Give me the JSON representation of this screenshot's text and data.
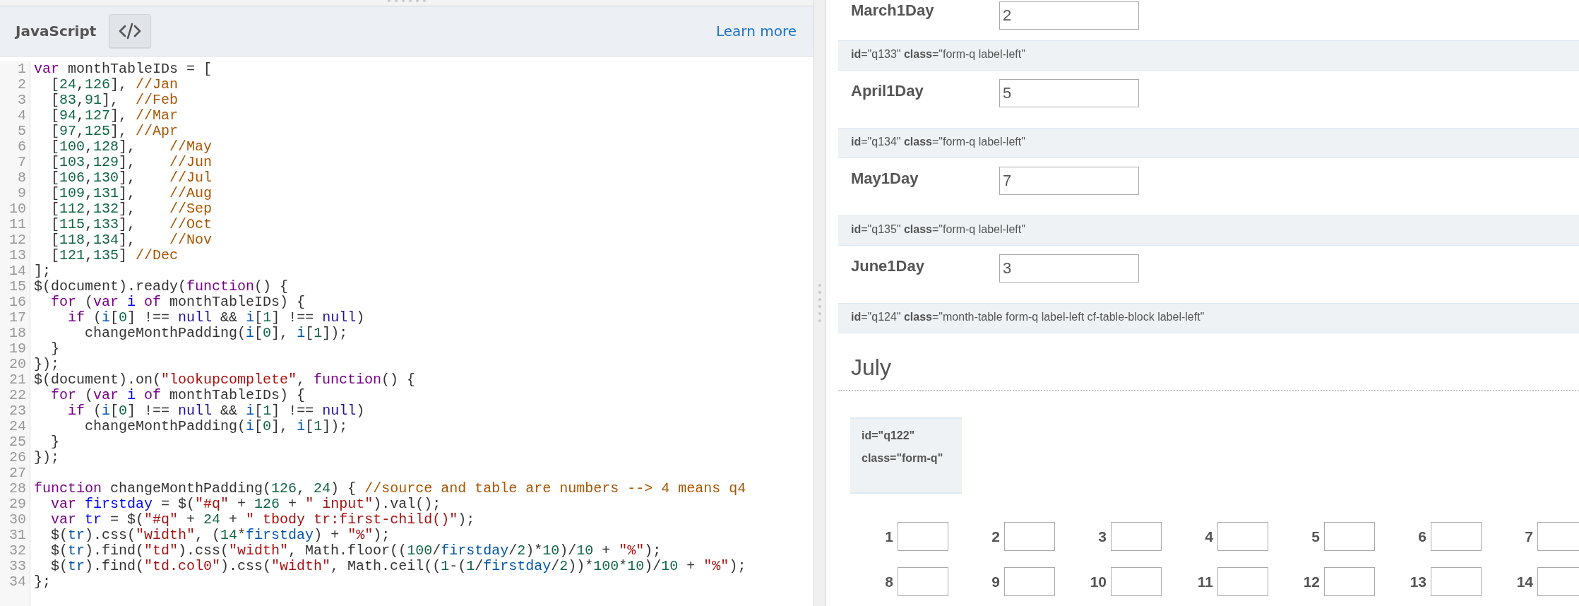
{
  "editor": {
    "language": "JavaScript",
    "link": "Learn more",
    "lines": [
      {
        "number": "1",
        "tokens": [
          {
            "kind": "keyword",
            "text": "var"
          },
          {
            "kind": "plain",
            "text": " monthTableIDs = ["
          }
        ]
      },
      {
        "number": "2",
        "tokens": [
          {
            "kind": "plain",
            "text": "  ["
          },
          {
            "kind": "number",
            "text": "24"
          },
          {
            "kind": "plain",
            "text": ","
          },
          {
            "kind": "number",
            "text": "126"
          },
          {
            "kind": "plain",
            "text": "], "
          },
          {
            "kind": "comment",
            "text": "//Jan"
          }
        ]
      },
      {
        "number": "3",
        "tokens": [
          {
            "kind": "plain",
            "text": "  ["
          },
          {
            "kind": "number",
            "text": "83"
          },
          {
            "kind": "plain",
            "text": ","
          },
          {
            "kind": "number",
            "text": "91"
          },
          {
            "kind": "plain",
            "text": "],  "
          },
          {
            "kind": "comment",
            "text": "//Feb"
          }
        ]
      },
      {
        "number": "4",
        "tokens": [
          {
            "kind": "plain",
            "text": "  ["
          },
          {
            "kind": "number",
            "text": "94"
          },
          {
            "kind": "plain",
            "text": ","
          },
          {
            "kind": "number",
            "text": "127"
          },
          {
            "kind": "plain",
            "text": "], "
          },
          {
            "kind": "comment",
            "text": "//Mar"
          }
        ]
      },
      {
        "number": "5",
        "tokens": [
          {
            "kind": "plain",
            "text": "  ["
          },
          {
            "kind": "number",
            "text": "97"
          },
          {
            "kind": "plain",
            "text": ","
          },
          {
            "kind": "number",
            "text": "125"
          },
          {
            "kind": "plain",
            "text": "], "
          },
          {
            "kind": "comment",
            "text": "//Apr"
          }
        ]
      },
      {
        "number": "6",
        "tokens": [
          {
            "kind": "plain",
            "text": "  ["
          },
          {
            "kind": "number",
            "text": "100"
          },
          {
            "kind": "plain",
            "text": ","
          },
          {
            "kind": "number",
            "text": "128"
          },
          {
            "kind": "plain",
            "text": "],    "
          },
          {
            "kind": "comment",
            "text": "//May"
          }
        ]
      },
      {
        "number": "7",
        "tokens": [
          {
            "kind": "plain",
            "text": "  ["
          },
          {
            "kind": "number",
            "text": "103"
          },
          {
            "kind": "plain",
            "text": ","
          },
          {
            "kind": "number",
            "text": "129"
          },
          {
            "kind": "plain",
            "text": "],    "
          },
          {
            "kind": "comment",
            "text": "//Jun"
          }
        ]
      },
      {
        "number": "8",
        "tokens": [
          {
            "kind": "plain",
            "text": "  ["
          },
          {
            "kind": "number",
            "text": "106"
          },
          {
            "kind": "plain",
            "text": ","
          },
          {
            "kind": "number",
            "text": "130"
          },
          {
            "kind": "plain",
            "text": "],    "
          },
          {
            "kind": "comment",
            "text": "//Jul"
          }
        ]
      },
      {
        "number": "9",
        "tokens": [
          {
            "kind": "plain",
            "text": "  ["
          },
          {
            "kind": "number",
            "text": "109"
          },
          {
            "kind": "plain",
            "text": ","
          },
          {
            "kind": "number",
            "text": "131"
          },
          {
            "kind": "plain",
            "text": "],    "
          },
          {
            "kind": "comment",
            "text": "//Aug"
          }
        ]
      },
      {
        "number": "10",
        "tokens": [
          {
            "kind": "plain",
            "text": "  ["
          },
          {
            "kind": "number",
            "text": "112"
          },
          {
            "kind": "plain",
            "text": ","
          },
          {
            "kind": "number",
            "text": "132"
          },
          {
            "kind": "plain",
            "text": "],    "
          },
          {
            "kind": "comment",
            "text": "//Sep"
          }
        ]
      },
      {
        "number": "11",
        "tokens": [
          {
            "kind": "plain",
            "text": "  ["
          },
          {
            "kind": "number",
            "text": "115"
          },
          {
            "kind": "plain",
            "text": ","
          },
          {
            "kind": "number",
            "text": "133"
          },
          {
            "kind": "plain",
            "text": "],    "
          },
          {
            "kind": "comment",
            "text": "//Oct"
          }
        ]
      },
      {
        "number": "12",
        "tokens": [
          {
            "kind": "plain",
            "text": "  ["
          },
          {
            "kind": "number",
            "text": "118"
          },
          {
            "kind": "plain",
            "text": ","
          },
          {
            "kind": "number",
            "text": "134"
          },
          {
            "kind": "plain",
            "text": "],    "
          },
          {
            "kind": "comment",
            "text": "//Nov"
          }
        ]
      },
      {
        "number": "13",
        "tokens": [
          {
            "kind": "plain",
            "text": "  ["
          },
          {
            "kind": "number",
            "text": "121"
          },
          {
            "kind": "plain",
            "text": ","
          },
          {
            "kind": "number",
            "text": "135"
          },
          {
            "kind": "plain",
            "text": "] "
          },
          {
            "kind": "comment",
            "text": "//Dec"
          }
        ]
      },
      {
        "number": "14",
        "tokens": [
          {
            "kind": "plain",
            "text": "];"
          }
        ]
      },
      {
        "number": "15",
        "tokens": [
          {
            "kind": "plain",
            "text": "$(document).ready("
          },
          {
            "kind": "keyword",
            "text": "function"
          },
          {
            "kind": "plain",
            "text": "() {"
          }
        ]
      },
      {
        "number": "16",
        "tokens": [
          {
            "kind": "keyword",
            "text": "  for"
          },
          {
            "kind": "plain",
            "text": " ("
          },
          {
            "kind": "keyword",
            "text": "var"
          },
          {
            "kind": "def",
            "text": " i"
          },
          {
            "kind": "keyword",
            "text": " of"
          },
          {
            "kind": "plain",
            "text": " monthTableIDs) {"
          }
        ]
      },
      {
        "number": "17",
        "tokens": [
          {
            "kind": "keyword",
            "text": "    if"
          },
          {
            "kind": "plain",
            "text": " ("
          },
          {
            "kind": "variable",
            "text": "i"
          },
          {
            "kind": "plain",
            "text": "["
          },
          {
            "kind": "number",
            "text": "0"
          },
          {
            "kind": "plain",
            "text": "] !== "
          },
          {
            "kind": "atom",
            "text": "null"
          },
          {
            "kind": "plain",
            "text": " && "
          },
          {
            "kind": "variable",
            "text": "i"
          },
          {
            "kind": "plain",
            "text": "["
          },
          {
            "kind": "number",
            "text": "1"
          },
          {
            "kind": "plain",
            "text": "] !== "
          },
          {
            "kind": "atom",
            "text": "null"
          },
          {
            "kind": "plain",
            "text": ")"
          }
        ]
      },
      {
        "number": "18",
        "tokens": [
          {
            "kind": "plain",
            "text": "      changeMonthPadding("
          },
          {
            "kind": "variable",
            "text": "i"
          },
          {
            "kind": "plain",
            "text": "["
          },
          {
            "kind": "number",
            "text": "0"
          },
          {
            "kind": "plain",
            "text": "], "
          },
          {
            "kind": "variable",
            "text": "i"
          },
          {
            "kind": "plain",
            "text": "["
          },
          {
            "kind": "number",
            "text": "1"
          },
          {
            "kind": "plain",
            "text": "]);"
          }
        ]
      },
      {
        "number": "19",
        "tokens": [
          {
            "kind": "plain",
            "text": "  }"
          }
        ]
      },
      {
        "number": "20",
        "tokens": [
          {
            "kind": "plain",
            "text": "});"
          }
        ]
      },
      {
        "number": "21",
        "tokens": [
          {
            "kind": "plain",
            "text": "$(document).on("
          },
          {
            "kind": "string",
            "text": "\"lookupcomplete\""
          },
          {
            "kind": "plain",
            "text": ", "
          },
          {
            "kind": "keyword",
            "text": "function"
          },
          {
            "kind": "plain",
            "text": "() {"
          }
        ]
      },
      {
        "number": "22",
        "tokens": [
          {
            "kind": "keyword",
            "text": "  for"
          },
          {
            "kind": "plain",
            "text": " ("
          },
          {
            "kind": "keyword",
            "text": "var"
          },
          {
            "kind": "def",
            "text": " i"
          },
          {
            "kind": "keyword",
            "text": " of"
          },
          {
            "kind": "plain",
            "text": " monthTableIDs) {"
          }
        ]
      },
      {
        "number": "23",
        "tokens": [
          {
            "kind": "keyword",
            "text": "    if"
          },
          {
            "kind": "plain",
            "text": " ("
          },
          {
            "kind": "variable",
            "text": "i"
          },
          {
            "kind": "plain",
            "text": "["
          },
          {
            "kind": "number",
            "text": "0"
          },
          {
            "kind": "plain",
            "text": "] !== "
          },
          {
            "kind": "atom",
            "text": "null"
          },
          {
            "kind": "plain",
            "text": " && "
          },
          {
            "kind": "variable",
            "text": "i"
          },
          {
            "kind": "plain",
            "text": "["
          },
          {
            "kind": "number",
            "text": "1"
          },
          {
            "kind": "plain",
            "text": "] !== "
          },
          {
            "kind": "atom",
            "text": "null"
          },
          {
            "kind": "plain",
            "text": ")"
          }
        ]
      },
      {
        "number": "24",
        "tokens": [
          {
            "kind": "plain",
            "text": "      changeMonthPadding("
          },
          {
            "kind": "variable",
            "text": "i"
          },
          {
            "kind": "plain",
            "text": "["
          },
          {
            "kind": "number",
            "text": "0"
          },
          {
            "kind": "plain",
            "text": "], "
          },
          {
            "kind": "variable",
            "text": "i"
          },
          {
            "kind": "plain",
            "text": "["
          },
          {
            "kind": "number",
            "text": "1"
          },
          {
            "kind": "plain",
            "text": "]);"
          }
        ]
      },
      {
        "number": "25",
        "tokens": [
          {
            "kind": "plain",
            "text": "  }"
          }
        ]
      },
      {
        "number": "26",
        "tokens": [
          {
            "kind": "plain",
            "text": "});"
          }
        ]
      },
      {
        "number": "27"
      },
      {
        "number": "28",
        "tokens": [
          {
            "kind": "keyword",
            "text": "function"
          },
          {
            "kind": "plain",
            "text": " changeMonthPadding("
          },
          {
            "kind": "number",
            "text": "126"
          },
          {
            "kind": "plain",
            "text": ", "
          },
          {
            "kind": "number",
            "text": "24"
          },
          {
            "kind": "plain",
            "text": ") { "
          },
          {
            "kind": "comment",
            "text": "//source and table are numbers --> 4 means q4"
          }
        ]
      },
      {
        "number": "29",
        "tokens": [
          {
            "kind": "keyword",
            "text": "  var"
          },
          {
            "kind": "def",
            "text": " firstday"
          },
          {
            "kind": "plain",
            "text": " = $("
          },
          {
            "kind": "string",
            "text": "\"#q\""
          },
          {
            "kind": "plain",
            "text": " + "
          },
          {
            "kind": "number",
            "text": "126"
          },
          {
            "kind": "plain",
            "text": " + "
          },
          {
            "kind": "string",
            "text": "\" input\""
          },
          {
            "kind": "plain",
            "text": ").val();"
          }
        ]
      },
      {
        "number": "30",
        "tokens": [
          {
            "kind": "keyword",
            "text": "  var"
          },
          {
            "kind": "def",
            "text": " tr"
          },
          {
            "kind": "plain",
            "text": " = $("
          },
          {
            "kind": "string",
            "text": "\"#q\""
          },
          {
            "kind": "plain",
            "text": " + "
          },
          {
            "kind": "number",
            "text": "24"
          },
          {
            "kind": "plain",
            "text": " + "
          },
          {
            "kind": "string",
            "text": "\" tbody tr:first-child()\""
          },
          {
            "kind": "plain",
            "text": ");"
          }
        ]
      },
      {
        "number": "31",
        "tokens": [
          {
            "kind": "plain",
            "text": "  $("
          },
          {
            "kind": "variable",
            "text": "tr"
          },
          {
            "kind": "plain",
            "text": ").css("
          },
          {
            "kind": "string",
            "text": "\"width\""
          },
          {
            "kind": "plain",
            "text": ", ("
          },
          {
            "kind": "number",
            "text": "14"
          },
          {
            "kind": "plain",
            "text": "*"
          },
          {
            "kind": "variable",
            "text": "firstday"
          },
          {
            "kind": "plain",
            "text": ") + "
          },
          {
            "kind": "string",
            "text": "\"%\""
          },
          {
            "kind": "plain",
            "text": ");"
          }
        ]
      },
      {
        "number": "32",
        "tokens": [
          {
            "kind": "plain",
            "text": "  $("
          },
          {
            "kind": "variable",
            "text": "tr"
          },
          {
            "kind": "plain",
            "text": ").find("
          },
          {
            "kind": "string",
            "text": "\"td\""
          },
          {
            "kind": "plain",
            "text": ").css("
          },
          {
            "kind": "string",
            "text": "\"width\""
          },
          {
            "kind": "plain",
            "text": ", Math.floor(("
          },
          {
            "kind": "number",
            "text": "100"
          },
          {
            "kind": "plain",
            "text": "/"
          },
          {
            "kind": "variable",
            "text": "firstday"
          },
          {
            "kind": "plain",
            "text": "/"
          },
          {
            "kind": "number",
            "text": "2"
          },
          {
            "kind": "plain",
            "text": ")*"
          },
          {
            "kind": "number",
            "text": "10"
          },
          {
            "kind": "plain",
            "text": ")/"
          },
          {
            "kind": "number",
            "text": "10"
          },
          {
            "kind": "plain",
            "text": " + "
          },
          {
            "kind": "string",
            "text": "\"%\""
          },
          {
            "kind": "plain",
            "text": ");"
          }
        ]
      },
      {
        "number": "33",
        "tokens": [
          {
            "kind": "plain",
            "text": "  $("
          },
          {
            "kind": "variable",
            "text": "tr"
          },
          {
            "kind": "plain",
            "text": ").find("
          },
          {
            "kind": "string",
            "text": "\"td.col0\""
          },
          {
            "kind": "plain",
            "text": ").css("
          },
          {
            "kind": "string",
            "text": "\"width\""
          },
          {
            "kind": "plain",
            "text": ", Math.ceil(("
          },
          {
            "kind": "number",
            "text": "1"
          },
          {
            "kind": "plain",
            "text": "-("
          },
          {
            "kind": "number",
            "text": "1"
          },
          {
            "kind": "plain",
            "text": "/"
          },
          {
            "kind": "variable",
            "text": "firstday"
          },
          {
            "kind": "plain",
            "text": "/"
          },
          {
            "kind": "number",
            "text": "2"
          },
          {
            "kind": "plain",
            "text": "))*"
          },
          {
            "kind": "number",
            "text": "100"
          },
          {
            "kind": "plain",
            "text": "*"
          },
          {
            "kind": "number",
            "text": "10"
          },
          {
            "kind": "plain",
            "text": ")/"
          },
          {
            "kind": "number",
            "text": "10"
          },
          {
            "kind": "plain",
            "text": " + "
          },
          {
            "kind": "string",
            "text": "\"%\""
          },
          {
            "kind": "plain",
            "text": ");"
          }
        ]
      },
      {
        "number": "34",
        "tokens": [
          {
            "kind": "plain",
            "text": "};"
          }
        ]
      }
    ]
  },
  "form": {
    "items": [
      {
        "kind": "field",
        "label": "March1Day",
        "value": "2"
      },
      {
        "kind": "attributes",
        "text": "**id**=\"q133\" **class**=\"form-q label-left\""
      },
      {
        "kind": "field",
        "label": "April1Day",
        "value": "5"
      },
      {
        "kind": "attributes",
        "text": "**id**=\"q134\" **class**=\"form-q label-left\""
      },
      {
        "kind": "field",
        "label": "May1Day",
        "value": "7"
      },
      {
        "kind": "attributes",
        "text": "**id**=\"q135\" **class**=\"form-q label-left\""
      },
      {
        "kind": "field",
        "label": "June1Day",
        "value": "3"
      },
      {
        "kind": "attributes",
        "text": "**id**=\"q124\" **class**=\"month-table form-q label-left cf-table-block label-left\""
      }
    ],
    "section": {
      "heading": "July",
      "attributes": "id=\"q122\" class=\"form-q\"",
      "days": [
        {
          "label": "1"
        },
        {
          "label": "2"
        },
        {
          "label": "3"
        },
        {
          "label": "4"
        },
        {
          "label": "5"
        },
        {
          "label": "6"
        },
        {
          "label": "7"
        },
        {
          "label": "8"
        },
        {
          "label": "9"
        },
        {
          "label": "10"
        },
        {
          "label": "11"
        },
        {
          "label": "12"
        },
        {
          "label": "13"
        },
        {
          "label": "14"
        }
      ]
    }
  }
}
